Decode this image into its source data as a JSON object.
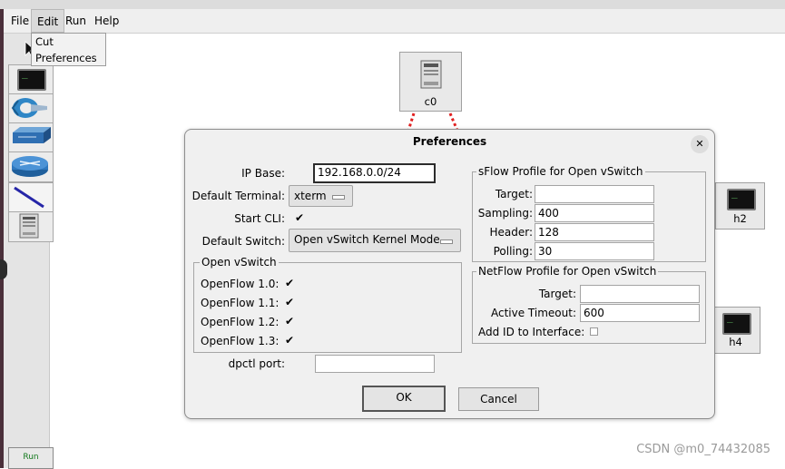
{
  "menubar": {
    "items": [
      "File",
      "Edit",
      "Run",
      "Help"
    ]
  },
  "edit_menu": {
    "items": [
      "Cut",
      "Preferences"
    ]
  },
  "toolbar": {
    "tools": [
      "select-cursor",
      "host",
      "switch",
      "legacy-switch",
      "legacy-router",
      "netlink",
      "controller"
    ],
    "run_label": "Run"
  },
  "canvas": {
    "controller": {
      "label": "c0"
    },
    "hosts": [
      {
        "label": "h2"
      },
      {
        "label": "h4"
      }
    ]
  },
  "dialog": {
    "title": "Preferences",
    "close_glyph": "✕",
    "ip_base": {
      "label": "IP Base:",
      "value": "192.168.0.0/24"
    },
    "default_terminal": {
      "label": "Default Terminal:",
      "value": "xterm"
    },
    "start_cli": {
      "label": "Start CLI:",
      "checked": true
    },
    "default_switch": {
      "label": "Default Switch:",
      "value": "Open vSwitch Kernel Mode"
    },
    "openvswitch": {
      "title": "Open vSwitch",
      "options": [
        {
          "label": "OpenFlow 1.0:",
          "checked": true
        },
        {
          "label": "OpenFlow 1.1:",
          "checked": true
        },
        {
          "label": "OpenFlow 1.2:",
          "checked": true
        },
        {
          "label": "OpenFlow 1.3:",
          "checked": true
        }
      ]
    },
    "dpctl_port": {
      "label": "dpctl port:",
      "value": ""
    },
    "sflow": {
      "title": "sFlow Profile for Open vSwitch",
      "target": {
        "label": "Target:",
        "value": ""
      },
      "sampling": {
        "label": "Sampling:",
        "value": "400"
      },
      "header": {
        "label": "Header:",
        "value": "128"
      },
      "polling": {
        "label": "Polling:",
        "value": "30"
      }
    },
    "netflow": {
      "title": "NetFlow Profile for Open vSwitch",
      "target": {
        "label": "Target:",
        "value": ""
      },
      "active_timeout": {
        "label": "Active Timeout:",
        "value": "600"
      },
      "add_id": {
        "label": "Add ID to Interface:",
        "checked": false
      }
    },
    "ok_label": "OK",
    "cancel_label": "Cancel"
  },
  "check_glyph": "✔",
  "watermark": "CSDN @m0_74432085"
}
